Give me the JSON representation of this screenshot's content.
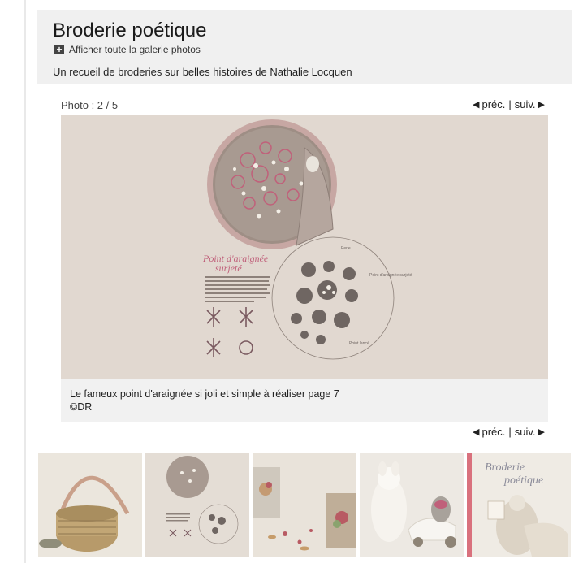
{
  "header": {
    "title": "Broderie poétique",
    "gallery_link": "Afficher toute la galerie photos",
    "subtitle": "Un recueil de broderies sur belles histoires de Nathalie Locquen"
  },
  "viewer": {
    "counter": "Photo : 2 / 5",
    "prev_label": "préc.",
    "next_label": "suiv.",
    "separator": "|",
    "prev_arrow": "◀",
    "next_arrow": "▶",
    "caption": "Le fameux point d'araignée si joli et simple à réaliser page 7",
    "credit": "©DR"
  },
  "photo_text": {
    "heading_line1": "Point d'araignée",
    "heading_line2": "surjeté",
    "label_perle": "Perle",
    "label_point_araignee": "Point d'araignée surjeté",
    "label_point_lance": "Point lancé"
  },
  "thumb_text": {
    "book_title_line1": "Broderie",
    "book_title_line2": "poétique"
  },
  "thumbnails": [
    {
      "subject": "basket-bag"
    },
    {
      "subject": "spider-stitch-page"
    },
    {
      "subject": "embroidered-notebook"
    },
    {
      "subject": "toys"
    },
    {
      "subject": "book-cover"
    }
  ],
  "colors": {
    "header_bg": "#f0f0f0",
    "caption_bg": "#f1f1f1",
    "photo_bg": "#e1d8d0",
    "embroidery_pink": "#c0607a"
  }
}
